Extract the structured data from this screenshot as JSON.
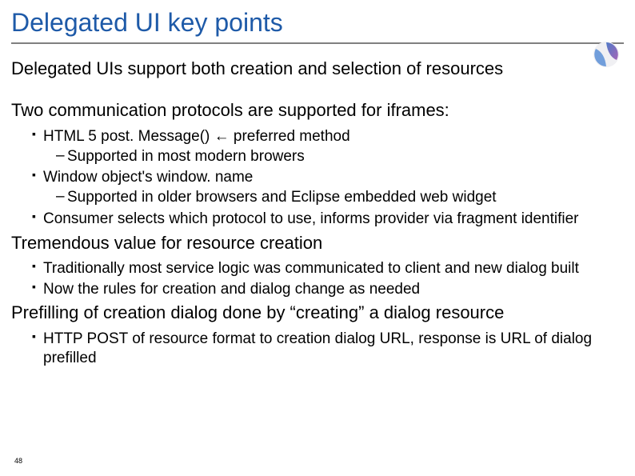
{
  "title": "Delegated UI key points",
  "page_number": "48",
  "sections": {
    "s1": {
      "heading": "Delegated UIs support both creation and selection of resources"
    },
    "s2": {
      "heading": "Two communication protocols are supported for iframes:",
      "b1": "HTML 5 post. Message() ← preferred method",
      "b1a": "Supported in most modern browers",
      "b2": "Window object's window. name",
      "b2a": "Supported in older browsers and Eclipse embedded web widget",
      "b3": "Consumer selects which protocol to use, informs provider via fragment identifier"
    },
    "s3": {
      "heading": "Tremendous value for resource creation",
      "b1": "Traditionally most service logic was communicated to client and new dialog built",
      "b2": "Now the rules for creation and dialog change as needed"
    },
    "s4": {
      "heading": "Prefilling of creation dialog done by “creating” a dialog resource",
      "b1": "HTTP POST of resource format to creation dialog URL, response is URL of dialog prefilled"
    }
  }
}
